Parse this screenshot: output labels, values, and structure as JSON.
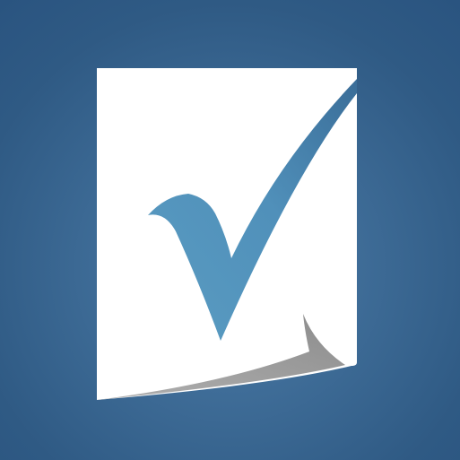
{
  "app": {
    "icon_name": "document-checkmark-icon",
    "colors": {
      "tile_center": "#4f7fa8",
      "tile_edge": "#2a5480",
      "page": "#ffffff",
      "curl_shadow": "#9a9a9a",
      "check_light": "#5a9cc2",
      "check_dark": "#3a6d98"
    }
  }
}
